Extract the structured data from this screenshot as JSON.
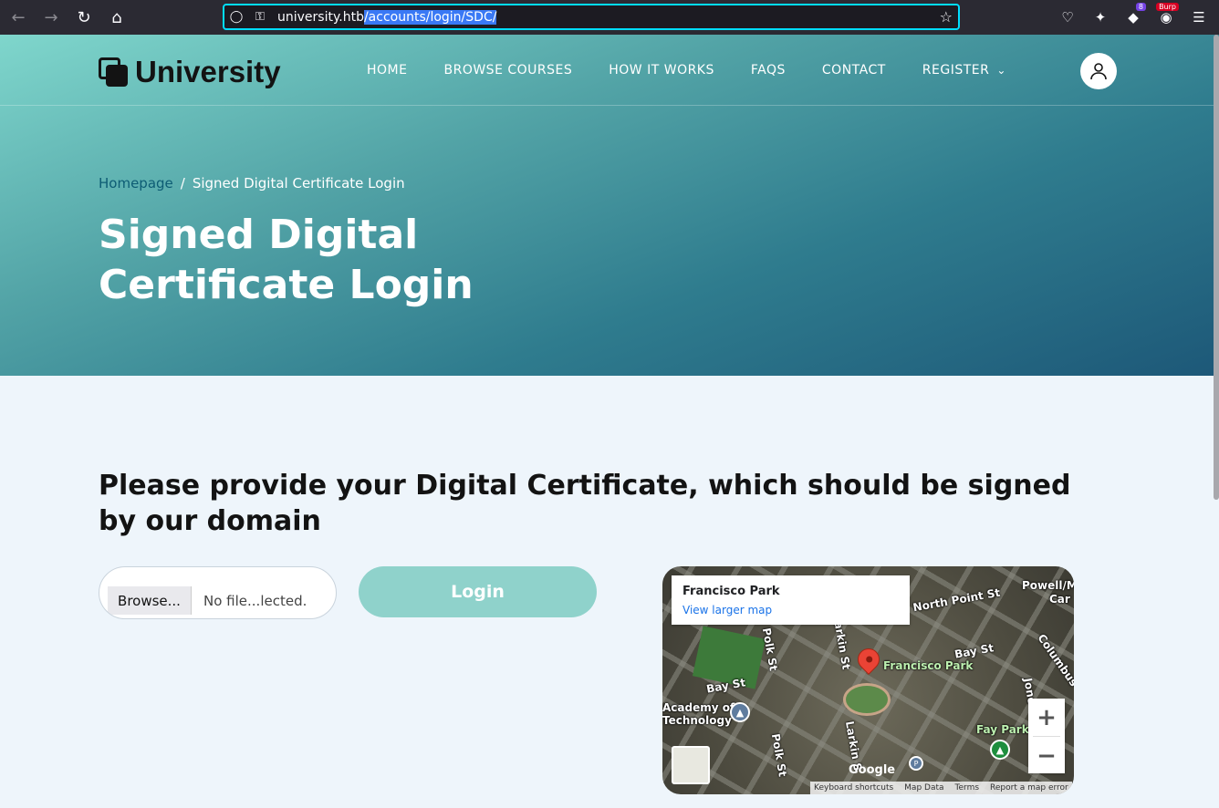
{
  "browser": {
    "url_host": "university.htb",
    "url_path": "/accounts/login/SDC/",
    "ext_badge_count": "8",
    "burp_badge": "Burp"
  },
  "site": {
    "logo_text": "University",
    "menu": [
      "HOME",
      "BROWSE COURSES",
      "HOW IT WORKS",
      "FAQS",
      "CONTACT",
      "REGISTER"
    ]
  },
  "hero": {
    "breadcrumb_home": "Homepage",
    "breadcrumb_sep": "/",
    "breadcrumb_current": "Signed Digital Certificate Login",
    "title": "Signed Digital Certificate Login"
  },
  "content": {
    "heading": "Please provide your Digital Certificate, which should be signed by our domain",
    "browse_label": "Browse...",
    "file_status": "No file...lected.",
    "login_label": "Login"
  },
  "map": {
    "place": "Francisco Park",
    "larger_link": "View larger map",
    "labels": [
      "North Point St",
      "Bay St",
      "Bay St",
      "Polk St",
      "Larkin St",
      "Francisco Park",
      "Fay Park",
      "Academy of",
      "Technology",
      "Columbus",
      "Powell/M",
      "Car",
      "Polk St",
      "Larkin S",
      "Jone"
    ],
    "google": "Google",
    "footer": [
      "Keyboard shortcuts",
      "Map Data",
      "Terms",
      "Report a map error"
    ]
  },
  "colors": {
    "accent": "#8fd2cb",
    "hero_dark": "#1d5878",
    "link": "#1a73e8"
  }
}
